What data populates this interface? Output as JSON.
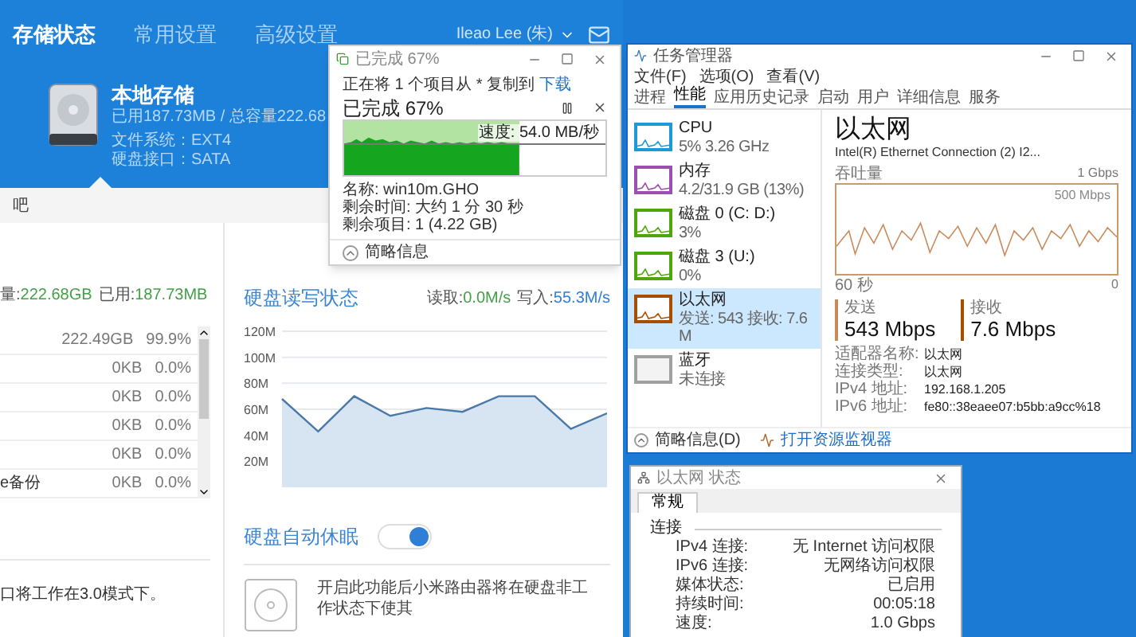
{
  "router": {
    "nav": [
      {
        "label": "存储状态",
        "selected": true
      },
      {
        "label": "常用设置",
        "selected": false
      },
      {
        "label": "高级设置",
        "selected": false
      }
    ],
    "user": "Ileao Lee (朱)",
    "storage": {
      "name": "本地存储",
      "lines": [
        "已用187.73MB / 总容量222.68",
        "文件系统：EXT4",
        "硬盘接口：SATA"
      ]
    },
    "section_bar": "吧",
    "summary": [
      {
        "label": "量:",
        "value": "222.68GB"
      },
      {
        "label": "已用:",
        "value": "187.73MB"
      }
    ],
    "rows": [
      {
        "size": "222.49GB",
        "percent": "99.9%"
      },
      {
        "size": "0KB",
        "percent": "0.0%"
      },
      {
        "size": "0KB",
        "percent": "0.0%"
      },
      {
        "size": "0KB",
        "percent": "0.0%"
      },
      {
        "size": "0KB",
        "percent": "0.0%"
      },
      {
        "name": "e备份",
        "size": "0KB",
        "percent": "0.0%"
      }
    ],
    "usb_note": "口将工作在3.0模式下。",
    "rates": [
      {
        "label": "读取:",
        "value": "0.0M/s",
        "color": "#43a047"
      },
      {
        "label": "写入:",
        "value": "55.3M/s",
        "color": "#2f7fd6"
      }
    ],
    "chart_data": {
      "type": "area",
      "title": "硬盘读写状态",
      "grid": true,
      "ylim": [
        0,
        120
      ],
      "yticks": [
        {
          "value": 20,
          "label": "20M"
        },
        {
          "value": 40,
          "label": "40M"
        },
        {
          "value": 60,
          "label": "60M"
        },
        {
          "value": 80,
          "label": "80M"
        },
        {
          "value": 100,
          "label": "100M"
        },
        {
          "value": 120,
          "label": "120M"
        }
      ],
      "series": [
        {
          "color": "#4a78a8",
          "values": [
            68,
            43,
            70,
            55,
            61,
            58,
            70,
            70,
            45,
            57
          ]
        }
      ]
    },
    "sleep": {
      "label": "硬盘自动休眠",
      "on": true,
      "description": "开启此功能后小米路由器将在硬盘非工作状态下使其"
    }
  },
  "copy_dialog": {
    "title": "已完成 67%",
    "source": "正在将 1 个项目从 * 复制到",
    "destination": "下载",
    "progress_text": "已完成 67%",
    "level": 0.67,
    "speed": "速度: 54.0 MB/秒",
    "details": [
      "名称: win10m.GHO",
      "剩余时间: 大约 1 分 30 秒",
      "剩余项目: 1 (4.22 GB)"
    ],
    "less": "简略信息"
  },
  "task_manager": {
    "title": "任务管理器",
    "menu": [
      "文件(F)",
      "选项(O)",
      "查看(V)"
    ],
    "tabs": [
      {
        "label": "进程",
        "selected": false
      },
      {
        "label": "性能",
        "selected": true
      },
      {
        "label": "应用历史记录",
        "selected": false
      },
      {
        "label": "启动",
        "selected": false
      },
      {
        "label": "用户",
        "selected": false
      },
      {
        "label": "详细信息",
        "selected": false
      },
      {
        "label": "服务",
        "selected": false
      }
    ],
    "resources": [
      {
        "kind": "graph",
        "name": "CPU",
        "detail": "5% 3.26 GHz",
        "color": "#1a9ad6",
        "selected": false
      },
      {
        "kind": "graph",
        "name": "内存",
        "detail": "4.2/31.9 GB (13%)",
        "color": "#9b4fb0",
        "selected": false
      },
      {
        "kind": "graph",
        "name": "磁盘 0 (C: D:)",
        "detail": "3%",
        "color": "#4da60c",
        "selected": false
      },
      {
        "kind": "graph",
        "name": "磁盘 3 (U:)",
        "detail": "0%",
        "color": "#4da60c",
        "selected": false
      },
      {
        "kind": "graph",
        "name": "以太网",
        "detail": "发送: 543 接收: 7.6 M",
        "color": "#a74f01",
        "selected": true
      },
      {
        "kind": "empty",
        "name": "蓝牙",
        "detail": "未连接",
        "color": "#a0a0a0",
        "selected": false
      }
    ],
    "heading": "以太网",
    "adapter": "Intel(R) Ethernet Connection (2) I2...",
    "graph_label": "吞吐量",
    "graph_max": "1 Gbps",
    "graph_mid": "500 Mbps",
    "time_span": "60 秒",
    "time_end": "0",
    "throughput": [
      {
        "label": "发送",
        "value": "543 Mbps"
      },
      {
        "label": "接收",
        "value": "7.6 Mbps"
      }
    ],
    "properties": [
      {
        "label": "适配器名称:",
        "value": "以太网"
      },
      {
        "label": "连接类型:",
        "value": "以太网"
      },
      {
        "label": "IPv4 地址:",
        "value": "192.168.1.205"
      },
      {
        "label": "IPv6 地址:",
        "value": "fe80::38eaee07:b5bb:a9cc%18"
      }
    ],
    "footer": {
      "less": "简略信息(D)",
      "monitor": "打开资源监视器"
    }
  },
  "status_window": {
    "title": "以太网 状态",
    "tabs": [
      {
        "label": "常规",
        "selected": true
      }
    ],
    "group": "连接",
    "rows": [
      {
        "label": "IPv4 连接:",
        "value": "无 Internet 访问权限"
      },
      {
        "label": "IPv6 连接:",
        "value": "无网络访问权限"
      },
      {
        "label": "媒体状态:",
        "value": "已启用"
      },
      {
        "label": "持续时间:",
        "value": "00:05:18"
      },
      {
        "label": "速度:",
        "value": "1.0 Gbps"
      }
    ]
  }
}
